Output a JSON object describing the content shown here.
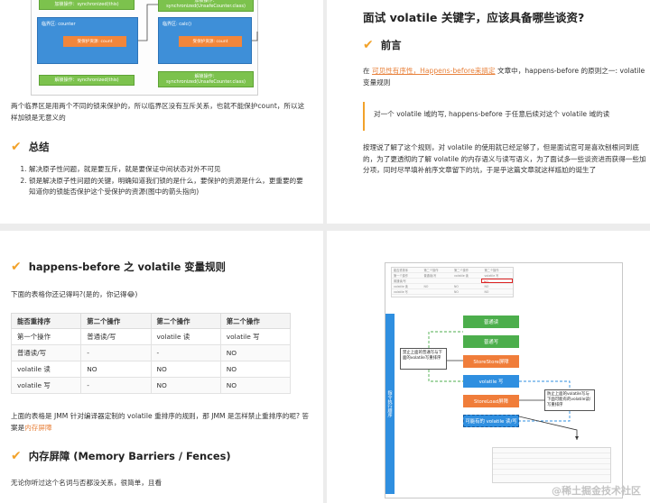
{
  "p1": {
    "diagram": {
      "left_top_bar": "加锁操作：synchronized(this)",
      "right_top_bar": "加锁操作：synchronized(UnsafeCounter.class)",
      "left_box_label": "临界区: counter",
      "right_box_label": "临界区: calc()",
      "left_inner_bar": "受保护资源: count",
      "right_inner_bar": "受保护资源: count",
      "left_bottom_bar": "解锁操作：synchronized(this)",
      "right_bottom_bar": "解锁操作：synchronized(UnsafeCounter.class)"
    },
    "paragraph": "两个临界区是用两个不同的锁来保护的，所以临界区没有互斥关系，也就不能保护count，所以这样加锁是无意义的",
    "summary_heading": "总结",
    "summary_items": [
      "解决原子性问题，就是要互斥，就是要保证中间状态对外不可见",
      "锁是解决原子性问题的关键，明确知道我们锁的是什么，要保护的资源是什么，更重要的要知道你的锁能否保护这个受保护的资源(图中的箭头指向)"
    ]
  },
  "p2": {
    "title": "面试 volatile 关键字，应该具备哪些谈资?",
    "section": "前言",
    "intro_pre": "在 ",
    "intro_link": "可见性有序性，Happens-before来搞定",
    "intro_post": " 文章中，happens-before 的原则之一: volatile变量规则",
    "quote": "对一个 volatile 域的写, happens-before 于任意后续对这个 volatile 域的读",
    "body": "按理说了解了这个规则，对 volatile 的使用就已经足够了，但是面试官可是喜欢刨根问到底的，为了更透彻的了解 volatile 的内存语义与读写语义，为了面试多一些谈资进而获得一些加分项，同时尽早填补前序文章留下的坑，于是乎这篇文章就这样尴尬的诞生了"
  },
  "p3": {
    "heading": "happens-before 之 volatile 变量规则",
    "lead": "下面的表格你还记得吗?(是的，你记得😂)",
    "table": {
      "headers": [
        "能否重排序",
        "第二个操作",
        "第二个操作",
        "第二个操作"
      ],
      "rows": [
        [
          "第一个操作",
          "普通读/写",
          "volatile 读",
          "volatile 写"
        ],
        [
          "普通读/写",
          "-",
          "-",
          "NO"
        ],
        [
          "volatile 读",
          "NO",
          "NO",
          "NO"
        ],
        [
          "volatile 写",
          "-",
          "NO",
          "NO"
        ]
      ]
    },
    "para_pre": "上面的表格是 JMM 针对编译器定制的 volatile 重排序的规则，那 JMM 是怎样禁止重排序的呢? 答案是",
    "para_link": "内存屏障",
    "subheading": "内存屏障 (Memory Barriers / Fences)",
    "tail": "无论你听过这个名词与否都没关系，很简单，且看"
  },
  "p4": {
    "vertical_label": "指令执行顺序",
    "boxes": [
      "普通读",
      "普通写",
      "StoreStore屏障",
      "volatile 写",
      "StoreLoad屏障",
      "可能有的 volatile 读/写"
    ],
    "note_left": "禁止上面的普通写与下面的volatile写重排序",
    "note_right": "防止上面的volatile写与下面可能有的volatile读/写重排序",
    "mini_table_top": [
      [
        "能否重排序",
        "第二个操作",
        "第二个操作",
        "第二个操作"
      ],
      [
        "第一个操作",
        "普通读/写",
        "volatile 读",
        "volatile 写"
      ],
      [
        "普通读/写",
        "",
        "",
        "NO"
      ],
      [
        "volatile 读",
        "NO",
        "NO",
        "NO"
      ],
      [
        "volatile 写",
        "",
        "NO",
        "NO"
      ]
    ],
    "watermark": "@稀土掘金技术社区",
    "colors": {
      "green": "#4cae4c",
      "blue": "#2f8fe0",
      "orange": "#f07d3a"
    }
  }
}
